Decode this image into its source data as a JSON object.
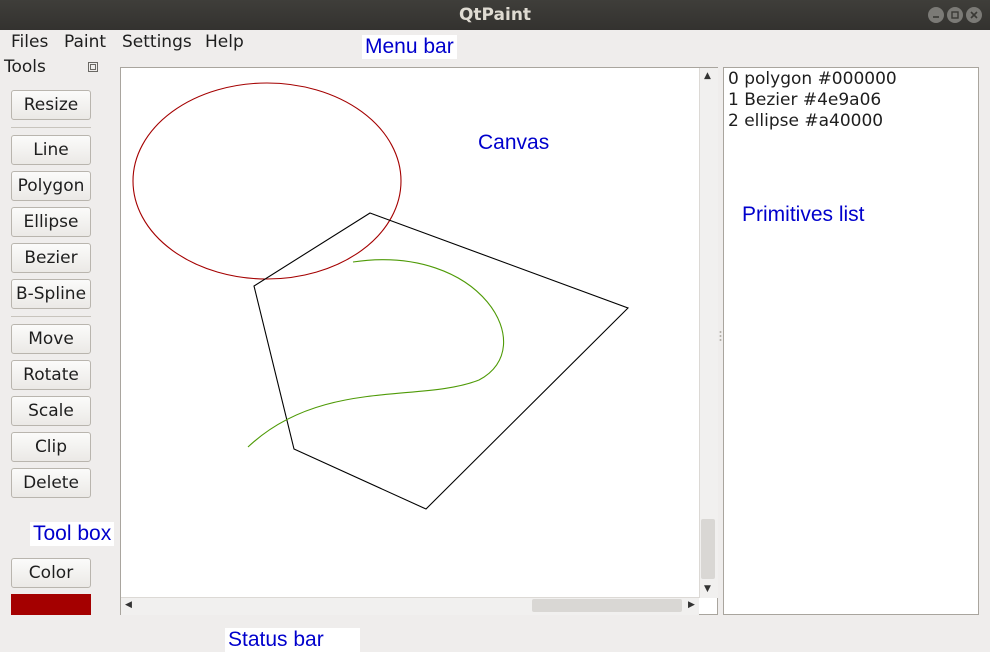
{
  "window": {
    "title": "QtPaint",
    "controls": [
      "minimize-icon",
      "maximize-icon",
      "close-icon"
    ]
  },
  "menubar": {
    "items": [
      "Files",
      "Paint",
      "Settings",
      "Help"
    ]
  },
  "toolbox": {
    "title": "Tools",
    "buttons": {
      "resize": "Resize",
      "line": "Line",
      "polygon": "Polygon",
      "ellipse": "Ellipse",
      "bezier": "Bezier",
      "bspline": "B-Spline",
      "move": "Move",
      "rotate": "Rotate",
      "scale": "Scale",
      "clip": "Clip",
      "delete": "Delete",
      "color": "Color"
    },
    "current_color": "#a40000"
  },
  "primitives": [
    "0 polygon #000000",
    "1 Bezier #4e9a06",
    "2 ellipse #a40000"
  ],
  "canvas": {
    "shapes": [
      {
        "type": "polygon",
        "color": "#000000"
      },
      {
        "type": "bezier",
        "color": "#4e9a06"
      },
      {
        "type": "ellipse",
        "color": "#a40000"
      }
    ]
  },
  "annotations": {
    "menu_bar": "Menu bar",
    "canvas": "Canvas",
    "primitives_list": "Primitives list",
    "tool_box": "Tool box",
    "status_bar": "Status bar"
  }
}
